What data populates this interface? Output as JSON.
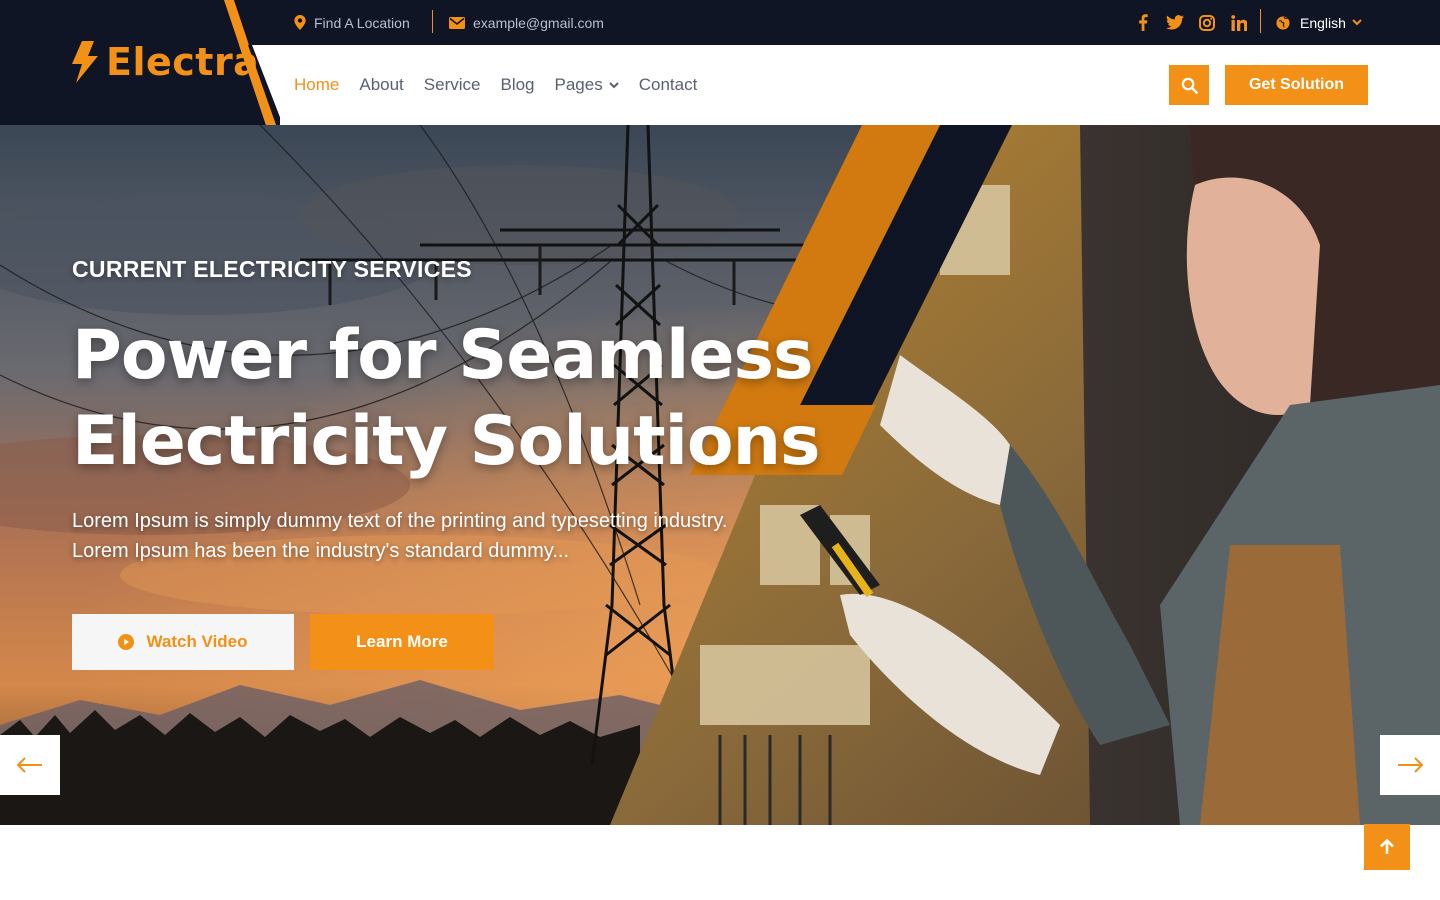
{
  "topbar": {
    "location": "Find A Location",
    "email": "example@gmail.com",
    "language": "English",
    "social": [
      "facebook-icon",
      "twitter-icon",
      "instagram-icon",
      "linkedin-icon"
    ]
  },
  "brand": {
    "name": "Electra"
  },
  "nav": {
    "items": [
      {
        "label": "Home",
        "active": true
      },
      {
        "label": "About"
      },
      {
        "label": "Service"
      },
      {
        "label": "Blog"
      },
      {
        "label": "Pages",
        "dropdown": true
      },
      {
        "label": "Contact"
      }
    ],
    "cta": "Get Solution"
  },
  "hero": {
    "eyebrow": "CURRENT ELECTRICITY SERVICES",
    "title_line1": "Power for Seamless",
    "title_line2": "Electricity Solutions",
    "desc_line1": "Lorem Ipsum is simply dummy text of the printing and typesetting industry.",
    "desc_line2": "Lorem Ipsum has been the industry's standard dummy...",
    "watch_label": "Watch Video",
    "learn_label": "Learn More"
  },
  "colors": {
    "accent": "#f39018",
    "dark": "#0f1525"
  }
}
